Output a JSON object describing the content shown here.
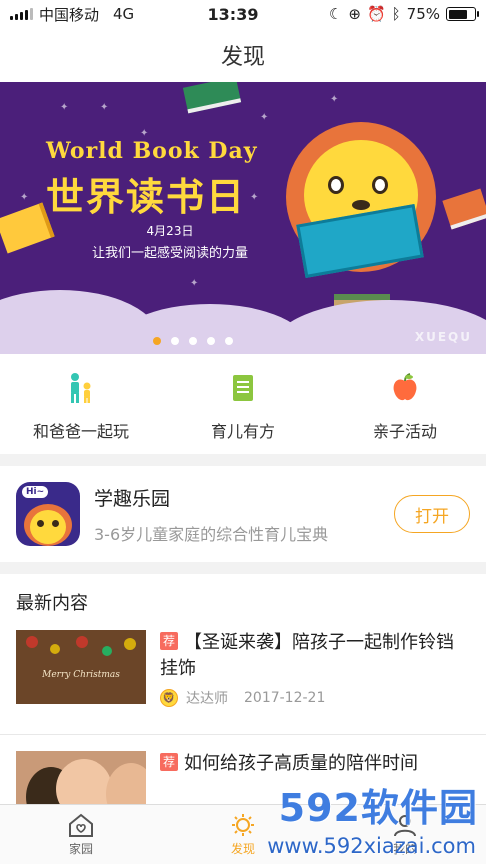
{
  "status": {
    "carrier": "中国移动",
    "network": "4G",
    "time": "13:39",
    "battery": "75%",
    "battery_level": 0.75
  },
  "nav": {
    "title": "发现"
  },
  "banner": {
    "title_en": "World Book Day",
    "title_zh": "世界读书日",
    "date": "4月23日",
    "subtitle": "让我们一起感受阅读的力量",
    "page_count": 5,
    "active_index": 0,
    "mark": "XUEQU"
  },
  "quick_links": [
    {
      "label": "和爸爸一起玩",
      "icon": "parent-child-icon",
      "color": "#33c6b3"
    },
    {
      "label": "育儿有方",
      "icon": "document-icon",
      "color": "#8cc63f"
    },
    {
      "label": "亲子活动",
      "icon": "apple-icon",
      "color": "#ff6b3d"
    }
  ],
  "app_promo": {
    "name": "学趣乐园",
    "description": "3-6岁儿童家庭的综合性育儿宝典",
    "button": "打开",
    "logo_badge": "Hi~"
  },
  "latest": {
    "title": "最新内容",
    "articles": [
      {
        "tag": "荐",
        "title": "【圣诞来袭】陪孩子一起制作铃铛挂饰",
        "author": "达达师",
        "date": "2017-12-21",
        "thumb_text": "Merry Christmas"
      },
      {
        "tag": "荐",
        "title": "如何给孩子高质量的陪伴时间"
      }
    ]
  },
  "tabs": [
    {
      "label": "家园",
      "icon": "home-icon",
      "active": false
    },
    {
      "label": "发现",
      "icon": "discover-icon",
      "active": true
    },
    {
      "label": "我的",
      "icon": "profile-icon",
      "active": false
    }
  ],
  "watermark": {
    "brand": "592软件园",
    "url": "www.592xiazai.com"
  },
  "colors": {
    "accent": "#f5a623",
    "banner_bg": "#4b1f7a",
    "tag": "#f76b5e"
  }
}
